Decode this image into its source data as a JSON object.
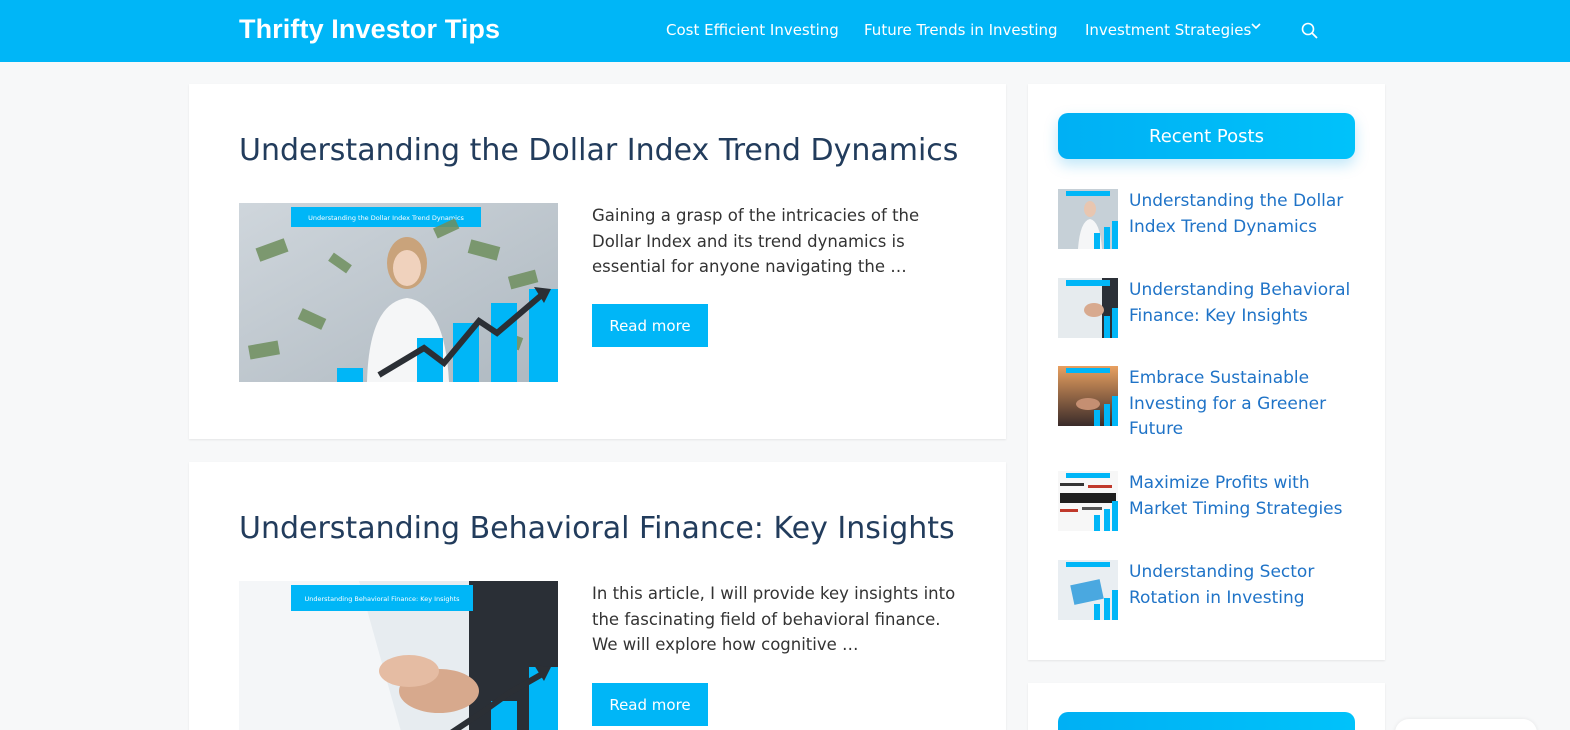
{
  "site": {
    "title": "Thrifty Investor Tips"
  },
  "nav": {
    "items": [
      {
        "label": "Cost Efficient Investing"
      },
      {
        "label": "Future Trends in Investing"
      },
      {
        "label": "Investment Strategies"
      }
    ],
    "dropdown_icon": "chevron-down-icon",
    "search_icon": "search-icon"
  },
  "posts": [
    {
      "title": "Understanding the Dollar Index Trend Dynamics",
      "image_caption": "Understanding the Dollar Index Trend Dynamics",
      "excerpt": "Gaining a grasp of the intricacies of the Dollar Index and its trend dynamics is essential for anyone navigating the …",
      "button": "Read more"
    },
    {
      "title": "Understanding Behavioral Finance: Key Insights",
      "image_caption": "Understanding Behavioral Finance: Key Insights",
      "excerpt": "In this article, I will provide key insights into the fascinating field of behavioral finance. We will explore how cognitive …",
      "button": "Read more"
    }
  ],
  "sidebar": {
    "recent_title": "Recent Posts",
    "recent": [
      {
        "title": "Understanding the Dollar Index Trend Dynamics"
      },
      {
        "title": "Understanding Behavioral Finance: Key Insights"
      },
      {
        "title": "Embrace Sustainable Investing for a Greener Future"
      },
      {
        "title": "Maximize Profits with Market Timing Strategies"
      },
      {
        "title": "Understanding Sector Rotation in Investing"
      }
    ]
  },
  "colors": {
    "brand": "#00b6f7",
    "title": "#223c5c",
    "link": "#1f73c7"
  }
}
